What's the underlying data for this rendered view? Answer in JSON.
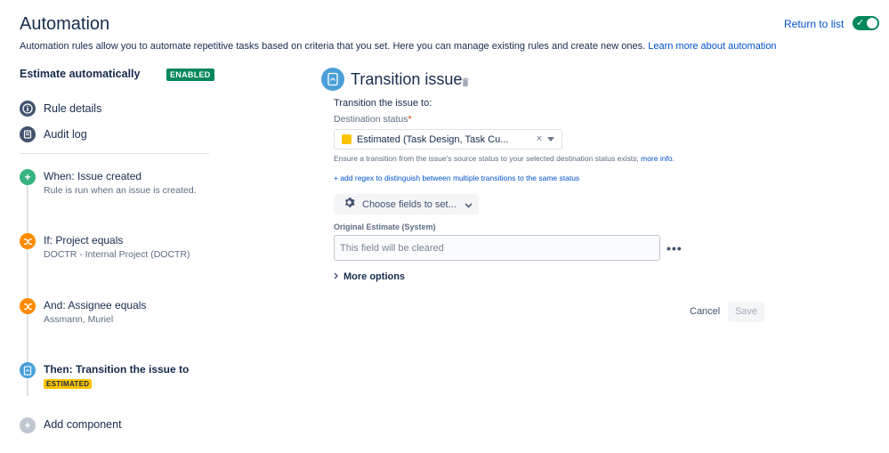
{
  "header": {
    "title": "Automation",
    "return_link": "Return to list",
    "intro_text": "Automation rules allow you to automate repetitive tasks based on criteria that you set. Here you can manage existing rules and create new ones.",
    "learn_more": "Learn more about automation"
  },
  "rule": {
    "name": "Estimate automatically",
    "status_badge": "ENABLED",
    "enabled": true
  },
  "sidebar": {
    "items": [
      {
        "label": "Rule details",
        "icon": "info-icon"
      },
      {
        "label": "Audit log",
        "icon": "log-icon"
      }
    ]
  },
  "steps": [
    {
      "kind": "trigger",
      "title": "When: Issue created",
      "subtitle": "Rule is run when an issue is created.",
      "color": "#36b37e",
      "icon": "plus-icon"
    },
    {
      "kind": "condition",
      "title": "If: Project equals",
      "subtitle": "DOCTR - Internal Project (DOCTR)",
      "color": "#ff8b00",
      "icon": "shuffle-icon"
    },
    {
      "kind": "condition",
      "title": "And: Assignee equals",
      "subtitle": "Assmann, Muriel",
      "color": "#ff8b00",
      "icon": "shuffle-icon"
    },
    {
      "kind": "action",
      "title": "Then: Transition the issue to",
      "lozenge": "ESTIMATED",
      "color": "#4a9fd8",
      "icon": "document-icon"
    },
    {
      "kind": "add",
      "title": "Add component",
      "color": "#c1c7d0",
      "icon": "plus-icon"
    }
  ],
  "action_panel": {
    "title": "Transition issue",
    "transition_label": "Transition the issue to:",
    "destination_label": "Destination status",
    "required_star": "*",
    "destination_value": "Estimated (Task Design, Task Cu...",
    "clear_symbol": "×",
    "hint_text": "Ensure a transition from the issue's source status to your selected destination status exists;",
    "hint_link": "more info.",
    "regex_link": "+ add regex to distinguish between multiple transitions to the same status",
    "choose_fields_label": "Choose fields to set...",
    "field_label": "Original Estimate (System)",
    "field_placeholder": "This field will be cleared",
    "more_dots": "•••",
    "more_options_label": "More options",
    "cancel_label": "Cancel",
    "save_label": "Save"
  },
  "colors": {
    "link": "#0052cc",
    "success": "#00875a",
    "warning": "#ffc400"
  }
}
